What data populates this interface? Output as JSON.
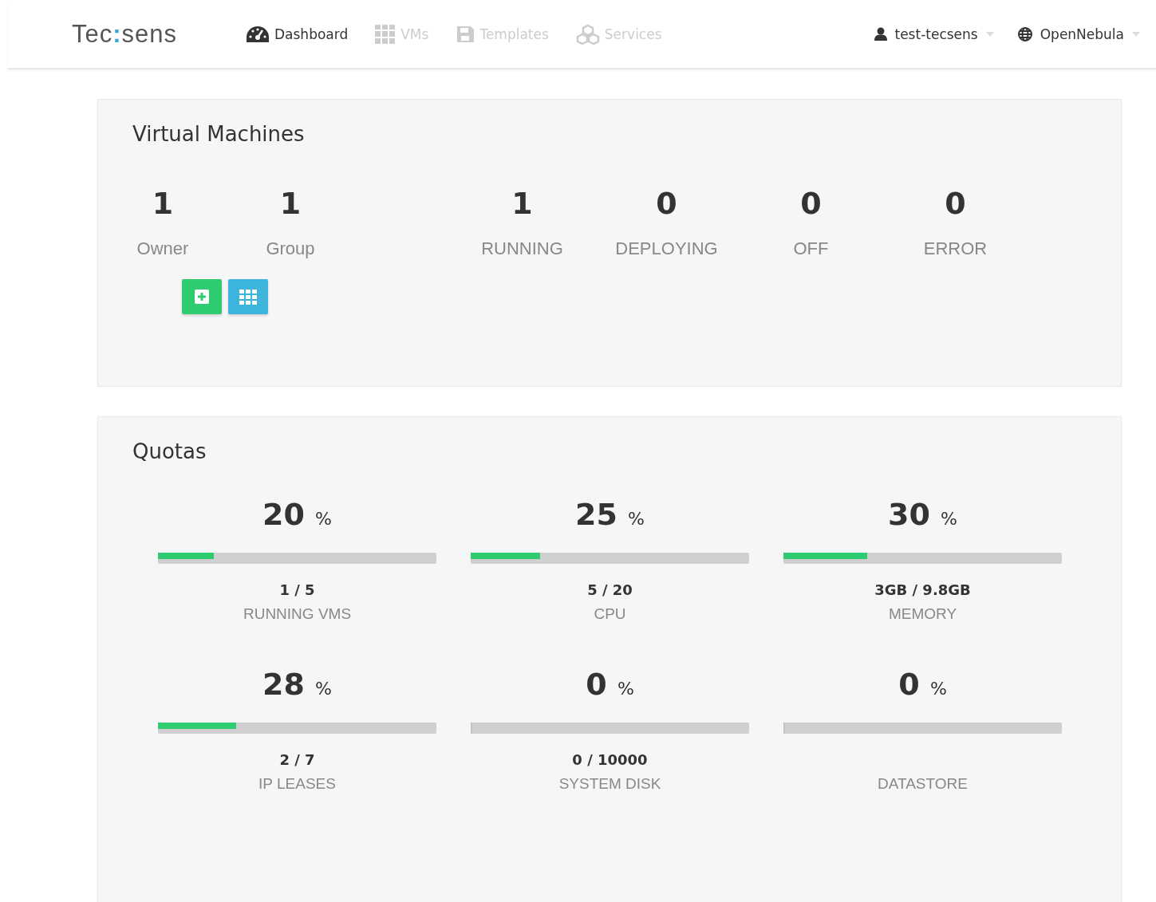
{
  "logo": [
    "Tec",
    ":",
    "sens"
  ],
  "nav": [
    {
      "label": "Dashboard",
      "kind": "dashboard",
      "selected": true
    },
    {
      "label": "VMs",
      "kind": "vms",
      "selected": false
    },
    {
      "label": "Templates",
      "kind": "templates",
      "selected": false
    },
    {
      "label": "Services",
      "kind": "services",
      "selected": false
    }
  ],
  "user_menu": {
    "label": "test-tecsens"
  },
  "zone_menu": {
    "label": "OpenNebula"
  },
  "vm_panel": {
    "title": "Virtual Machines",
    "ownership": [
      {
        "value": "1",
        "label": "Owner"
      },
      {
        "value": "1",
        "label": "Group"
      }
    ],
    "states": [
      {
        "value": "1",
        "label": "RUNNING"
      },
      {
        "value": "0",
        "label": "DEPLOYING"
      },
      {
        "value": "0",
        "label": "OFF"
      },
      {
        "value": "0",
        "label": "ERROR"
      }
    ],
    "buttons": [
      {
        "kind": "create"
      },
      {
        "kind": "list"
      }
    ]
  },
  "quotas": {
    "title": "Quotas",
    "items": [
      {
        "percent": "20",
        "unit": "%",
        "level": 0.2,
        "usage": "1 / 5",
        "label": "RUNNING VMS"
      },
      {
        "percent": "25",
        "unit": "%",
        "level": 0.25,
        "usage": "5 / 20",
        "label": "CPU"
      },
      {
        "percent": "30",
        "unit": "%",
        "level": 0.3,
        "usage": "3GB / 9.8GB",
        "label": "MEMORY"
      },
      {
        "percent": "28",
        "unit": "%",
        "level": 0.28,
        "usage": "2 / 7",
        "label": "IP LEASES"
      },
      {
        "percent": "0",
        "unit": "%",
        "level": 0,
        "usage": "0 / 10000",
        "label": "SYSTEM DISK"
      },
      {
        "percent": "0",
        "unit": "%",
        "level": 0,
        "label": "DATASTORE"
      }
    ]
  }
}
